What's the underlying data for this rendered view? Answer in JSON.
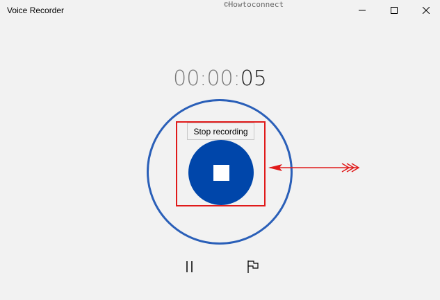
{
  "window": {
    "title": "Voice Recorder",
    "watermark": "©Howtoconnect",
    "controls": {
      "minimize_icon": "minimize-icon",
      "maximize_icon": "maximize-icon",
      "close_icon": "close-icon"
    }
  },
  "timer": {
    "dim_part": "00:00:",
    "seconds": "05"
  },
  "record": {
    "tooltip": "Stop recording",
    "stop_icon": "stop-icon",
    "accent_color": "#0046aa",
    "ring_color": "#2a5fb8"
  },
  "annotation": {
    "highlight_color": "#e01a1a"
  },
  "bottom_controls": {
    "pause_icon": "pause-icon",
    "flag_icon": "flag-marker-icon"
  }
}
